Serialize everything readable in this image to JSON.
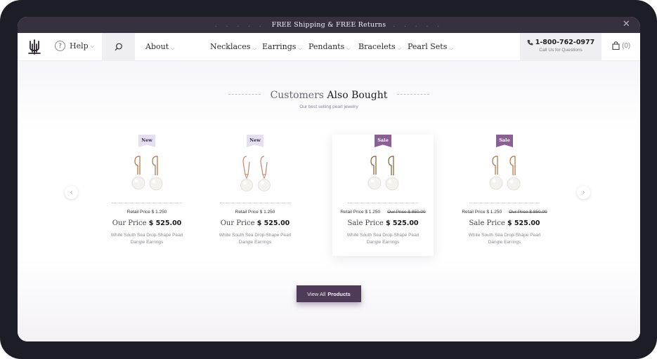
{
  "promo": {
    "text": "FREE Shipping & FREE Returns",
    "dots": ". . . . ."
  },
  "header": {
    "help_label": "Help",
    "nav": [
      "About",
      "Necklaces",
      "Earrings",
      "Pendants",
      "Bracelets",
      "Pearl Sets"
    ],
    "phone": "1-800-762-0977",
    "phone_sub": "Call Us for Questions",
    "cart_count": "(0)"
  },
  "section": {
    "title_light": "Customers",
    "title_bold": "Also Bought",
    "subtitle": "Our best selling pearl jewelry"
  },
  "products": [
    {
      "badge": "New",
      "retail": "Retail Price $ 1.250",
      "old_price": "",
      "price_label": "Our Price",
      "price": "$ 525.00",
      "name": "White South Sea Drop-Shape Pearl Dangle Earrings"
    },
    {
      "badge": "New",
      "retail": "Retail Price $ 1.250",
      "old_price": "",
      "price_label": "Our Price",
      "price": "$ 525.00",
      "name": "White South Sea Drop-Shape Pearl Dangle Earrings"
    },
    {
      "badge": "Sale",
      "retail": "Retail Price $ 1.250",
      "old_price": "Our Price $ 850.00",
      "price_label": "Sale Price",
      "price": "$ 525.00",
      "name": "White South Sea Drop-Shape Pearl Dangle Earrings"
    },
    {
      "badge": "Sale",
      "retail": "Retail Price $ 1.250",
      "old_price": "Our Price $ 850.00",
      "price_label": "Sale Price",
      "price": "$ 525.00",
      "name": "White South Sea Drop-Shape Pearl Dangle Earrings"
    }
  ],
  "cta": {
    "light": "View All",
    "bold": "Products"
  },
  "colors": {
    "promo_bg": "#37303e",
    "accent": "#4e3b57",
    "sale_badge": "#8a5f94",
    "new_badge": "#e6dff0"
  },
  "icons": {
    "logo": "trident-logo-icon",
    "help": "question-circle-icon",
    "search": "search-icon",
    "phone": "phone-icon",
    "cart": "shopping-bag-icon",
    "close": "close-icon",
    "prev": "chevron-left-icon",
    "next": "chevron-right-icon"
  }
}
